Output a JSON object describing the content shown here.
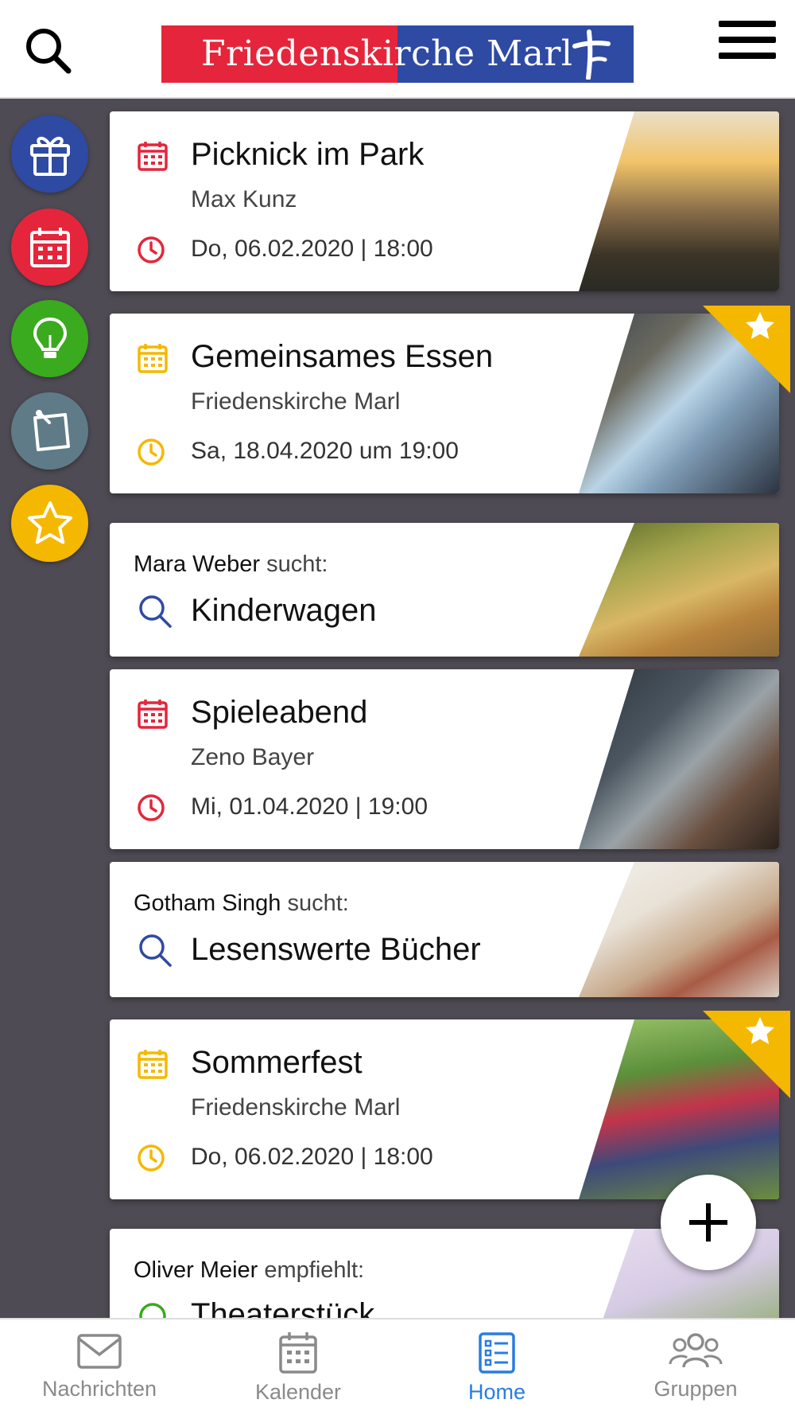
{
  "header": {
    "logo_text": "Friedenskirche Marl",
    "search_icon": "search-icon",
    "menu_icon": "hamburger-menu-icon",
    "logo_colors": {
      "left": "#e5253b",
      "right": "#2e4aa3"
    }
  },
  "sidebar": {
    "items": [
      {
        "icon": "gift-icon",
        "color": "#2e4aa3"
      },
      {
        "icon": "calendar-icon",
        "color": "#e5253b"
      },
      {
        "icon": "lightbulb-icon",
        "color": "#3aaa1e"
      },
      {
        "icon": "note-pin-icon",
        "color": "#5f7b88"
      },
      {
        "icon": "star-icon",
        "color": "#f5b800"
      }
    ]
  },
  "feed": {
    "events": [
      {
        "title": "Picknick im Park",
        "organizer": "Max Kunz",
        "datetime": "Do, 06.02.2020 | 18:00",
        "accent": "#e5253b",
        "favorite": false
      },
      {
        "title": "Gemeinsames Essen",
        "organizer": "Friedenskirche Marl",
        "datetime": "Sa, 18.04.2020 um 19:00",
        "accent": "#f5b800",
        "favorite": true
      },
      {
        "title": "Spieleabend",
        "organizer": "Zeno Bayer",
        "datetime": "Mi, 01.04.2020 | 19:00",
        "accent": "#e5253b",
        "favorite": false
      },
      {
        "title": "Sommerfest",
        "organizer": "Friedenskirche Marl",
        "datetime": "Do, 06.02.2020 | 18:00",
        "accent": "#f5b800",
        "favorite": true
      }
    ],
    "searches": [
      {
        "name": "Mara Weber",
        "verb": "sucht:",
        "item": "Kinderwagen"
      },
      {
        "name": "Gotham Singh",
        "verb": "sucht:",
        "item": "Lesenswerte Bücher"
      }
    ],
    "recommendation": {
      "name": "Oliver Meier",
      "verb": "empfiehlt:",
      "item": "Theaterstück"
    }
  },
  "fab": {
    "icon": "plus-icon"
  },
  "bottom_nav": {
    "items": [
      {
        "label": "Nachrichten",
        "icon": "mail-icon"
      },
      {
        "label": "Kalender",
        "icon": "calendar-icon"
      },
      {
        "label": "Home",
        "icon": "home-list-icon",
        "active": true
      },
      {
        "label": "Gruppen",
        "icon": "group-icon"
      }
    ],
    "active_color": "#2a7de1",
    "inactive_color": "#8a8a8a"
  }
}
